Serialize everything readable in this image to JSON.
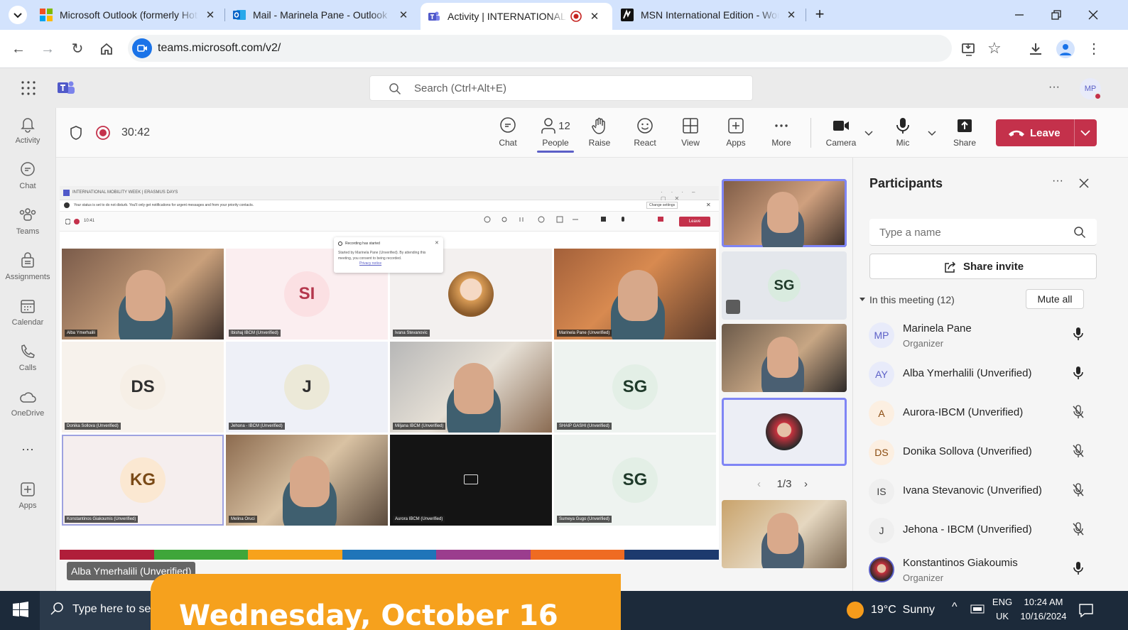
{
  "browser": {
    "tabs": [
      {
        "label": "Microsoft Outlook (formerly Hotmail)",
        "icon": "windows-icon"
      },
      {
        "label": "Mail - Marinela Pane - Outlook",
        "icon": "outlook-icon"
      },
      {
        "label": "Activity | INTERNATIONAL MOBILITY",
        "icon": "teams-icon"
      },
      {
        "label": "MSN International Edition - World",
        "icon": "msn-icon"
      }
    ],
    "url": "teams.microsoft.com/v2/"
  },
  "teams": {
    "search_placeholder": "Search (Ctrl+Alt+E)",
    "more": "···",
    "me_initials": "MP",
    "rail": [
      {
        "label": "Activity",
        "icon": "bell-icon"
      },
      {
        "label": "Chat",
        "icon": "chat-icon"
      },
      {
        "label": "Teams",
        "icon": "teams-group-icon"
      },
      {
        "label": "Assignments",
        "icon": "assignments-icon"
      },
      {
        "label": "Calendar",
        "icon": "calendar-icon"
      },
      {
        "label": "Calls",
        "icon": "phone-icon"
      },
      {
        "label": "OneDrive",
        "icon": "cloud-icon"
      },
      {
        "label": "Apps",
        "icon": "apps-icon"
      }
    ],
    "rail_more": "···"
  },
  "meeting": {
    "timer": "30:42",
    "toolbar": {
      "chat": "Chat",
      "people": "People",
      "people_count": "12",
      "raise": "Raise",
      "react": "React",
      "view": "View",
      "apps": "Apps",
      "more": "More",
      "camera": "Camera",
      "mic": "Mic",
      "share": "Share",
      "leave": "Leave"
    },
    "shared_screen": {
      "title": "INTERNATIONAL MOBILITY WEEK | ERASMUS DAYS",
      "notice": "Your status is set to do not disturb. You'll only get notifications for urgent messages and from your priority contacts.",
      "notice_action": "Change settings",
      "timer": "10:41",
      "popup_title": "Recording has started",
      "popup_text": "Started by Marinela Pane (Unverified). By attending this meeting, you consent to being recorded.",
      "popup_link": "Privacy notice",
      "leave": "Leave",
      "tiles": [
        {
          "name": "Alba Ymerhalili",
          "kind": "video",
          "initials": ""
        },
        {
          "name": "Ibishaj IBCM (Unverified)",
          "kind": "avatar",
          "initials": "SI"
        },
        {
          "name": "Ivana Stevanovic",
          "kind": "photo",
          "initials": ""
        },
        {
          "name": "Marinela Pane (Unverified)",
          "kind": "video",
          "initials": ""
        },
        {
          "name": "Donika Sollova (Unverified)",
          "kind": "avatar",
          "initials": "DS"
        },
        {
          "name": "Jehona - IBCM (Unverified)",
          "kind": "avatar",
          "initials": "J"
        },
        {
          "name": "Miljana IBCM (Unverified)",
          "kind": "video",
          "initials": ""
        },
        {
          "name": "SHAIP GASHI (Unverified)",
          "kind": "avatar",
          "initials": "SG"
        },
        {
          "name": "Konstantinos Giakoumis (Unverified)",
          "kind": "avatar",
          "initials": "KG"
        },
        {
          "name": "Melina Oruci",
          "kind": "video",
          "initials": ""
        },
        {
          "name": "Aurora IBCM (Unverified)",
          "kind": "cameraoff",
          "initials": ""
        },
        {
          "name": "Sumeya Gugo (Unverified)",
          "kind": "avatar",
          "initials": "SG"
        }
      ],
      "presenter_label": "Alba Ymerhalili (Unverified)"
    },
    "strip": {
      "tiles": [
        {
          "kind": "video",
          "initials": ""
        },
        {
          "kind": "avatar",
          "initials": "SG"
        },
        {
          "kind": "video",
          "initials": ""
        },
        {
          "kind": "photo",
          "initials": ""
        },
        {
          "kind": "video",
          "initials": ""
        }
      ],
      "pager": "1/3"
    },
    "participants": {
      "title": "Participants",
      "search_placeholder": "Type a name",
      "share_invite": "Share invite",
      "section": "In this meeting (12)",
      "mute_all": "Mute all",
      "people": [
        {
          "initials": "MP",
          "name": "Marinela Pane",
          "role": "Organizer",
          "mic": "on"
        },
        {
          "initials": "AY",
          "name": "Alba Ymerhalili (Unverified)",
          "role": "",
          "mic": "on"
        },
        {
          "initials": "A",
          "name": "Aurora-IBCM (Unverified)",
          "role": "",
          "mic": "off"
        },
        {
          "initials": "DS",
          "name": "Donika Sollova (Unverified)",
          "role": "",
          "mic": "off"
        },
        {
          "initials": "IS",
          "name": "Ivana Stevanovic (Unverified)",
          "role": "",
          "mic": "off"
        },
        {
          "initials": "J",
          "name": "Jehona - IBCM (Unverified)",
          "role": "",
          "mic": "off"
        },
        {
          "initials": "",
          "name": "Konstantinos Giakoumis",
          "role": "Organizer",
          "mic": "on"
        }
      ]
    }
  },
  "taskbar": {
    "search_placeholder": "Type here to search",
    "weather": "19°C  Sunny",
    "lang_top": "ENG",
    "lang_bottom": "UK",
    "time": "10:24 AM",
    "date": "10/16/2024"
  },
  "banner": {
    "text": "Wednesday, October 16"
  },
  "colors": {
    "teams_purple": "#5b5fc7",
    "leave_red": "#c4314b",
    "banner_orange": "#f6a11d",
    "chrome_tab_strip": "#d3e3fd"
  }
}
